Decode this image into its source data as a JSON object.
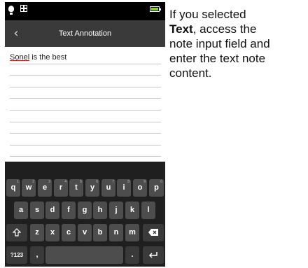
{
  "phone": {
    "action_bar": {
      "title": "Text Annotation",
      "back_icon": "chevron-left-icon"
    },
    "status_bar": {
      "icons": [
        "lightbulb-icon",
        "grid-icon",
        "battery-icon"
      ],
      "battery_color": "#7ed321"
    },
    "note": {
      "text_misspelled": "Sonel",
      "text_rest": " is the best",
      "spellcheck_color": "#e02020"
    },
    "keyboard": {
      "row1": [
        {
          "label": "q",
          "num": "1"
        },
        {
          "label": "w",
          "num": "2"
        },
        {
          "label": "e",
          "num": "3"
        },
        {
          "label": "r",
          "num": "4"
        },
        {
          "label": "t",
          "num": "5"
        },
        {
          "label": "y",
          "num": "6"
        },
        {
          "label": "u",
          "num": "7"
        },
        {
          "label": "i",
          "num": "8"
        },
        {
          "label": "o",
          "num": "9"
        },
        {
          "label": "p",
          "num": "0"
        }
      ],
      "row2": [
        "a",
        "s",
        "d",
        "f",
        "g",
        "h",
        "j",
        "k",
        "l"
      ],
      "row3": [
        "z",
        "x",
        "c",
        "v",
        "b",
        "n",
        "m"
      ],
      "shift_icon": "shift-icon",
      "delete_icon": "backspace-icon",
      "symbols_label": "?123",
      "comma_label": ",",
      "period_label": ".",
      "enter_icon": "enter-icon"
    }
  },
  "instruction": {
    "line1": "If you selected",
    "bold_word": "Text",
    "line2_rest": ", access the",
    "line3": "note input field and",
    "line4": "enter the text note",
    "line5": "content."
  }
}
